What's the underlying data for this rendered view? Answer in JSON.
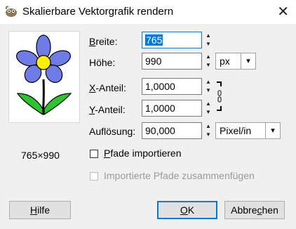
{
  "window": {
    "title": "Skalierbare Vektorgrafik rendern",
    "close_glyph": "✕"
  },
  "preview": {
    "dimensions": "765×990"
  },
  "fields": {
    "width_label_accel": "B",
    "width_label_rest": "reite:",
    "width_value": "765",
    "height_label": "Höhe:",
    "height_value": "990",
    "height_unit": "px",
    "xratio_label_accel": "X",
    "xratio_label_rest": "-Anteil:",
    "xratio_value": "1,0000",
    "yratio_label_accel": "Y",
    "yratio_label_rest": "-Anteil:",
    "yratio_value": "1,0000",
    "resolution_label": "Auflösung:",
    "resolution_value": "90,000",
    "resolution_unit": "Pixel/in"
  },
  "options": {
    "import_paths_accel": "P",
    "import_paths_rest": "fade importieren",
    "import_paths_checked": false,
    "merge_paths_label": "Importierte Pfade zusammenfügen",
    "merge_paths_checked": false
  },
  "buttons": {
    "help_accel": "H",
    "help_rest": "ilfe",
    "ok_accel": "O",
    "ok_rest": "K",
    "cancel_pre": "Abbre",
    "cancel_accel": "c",
    "cancel_post": "hen"
  },
  "colors": {
    "accent": "#0078d7",
    "petal": "#6f7be6",
    "center": "#ffef00",
    "leaf": "#2fc42f"
  }
}
